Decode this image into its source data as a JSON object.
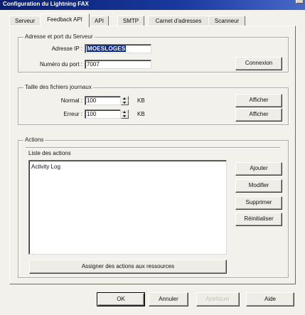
{
  "window": {
    "title": "Configuration du Lightning FAX"
  },
  "tabs": [
    {
      "label": "Serveur",
      "active": false
    },
    {
      "label": "Feedback API",
      "active": true
    },
    {
      "label": "API",
      "active": false
    },
    {
      "label": "SMTP",
      "active": false
    },
    {
      "label": "Carnet d'adresses",
      "active": false
    },
    {
      "label": "Scanneur",
      "active": false
    }
  ],
  "server_group": {
    "title": "Adresse et port du Serveur",
    "ip_label": "Adresse IP :",
    "ip_value": "MOESLOGES",
    "port_label": "Numéro du port :",
    "port_value": "7007",
    "connect_button": "Connexion"
  },
  "log_group": {
    "title": "Taille des fichiers journaux",
    "normal_label": "Normal :",
    "normal_value": "100",
    "error_label": "Erreur :",
    "error_value": "100",
    "unit": "KB",
    "show_button": "Afficher"
  },
  "actions_group": {
    "title": "Actions",
    "list_label": "Liste des actions",
    "items": [
      "Activity Log"
    ],
    "add_button": "Ajouter",
    "modify_button": "Modifier",
    "delete_button": "Supprimer",
    "reset_button": "Réinitialiser",
    "assign_button": "Assigner des actions aux ressources"
  },
  "footer": {
    "ok": "OK",
    "cancel": "Annuler",
    "apply": "Appliquer",
    "help": "Aide"
  }
}
